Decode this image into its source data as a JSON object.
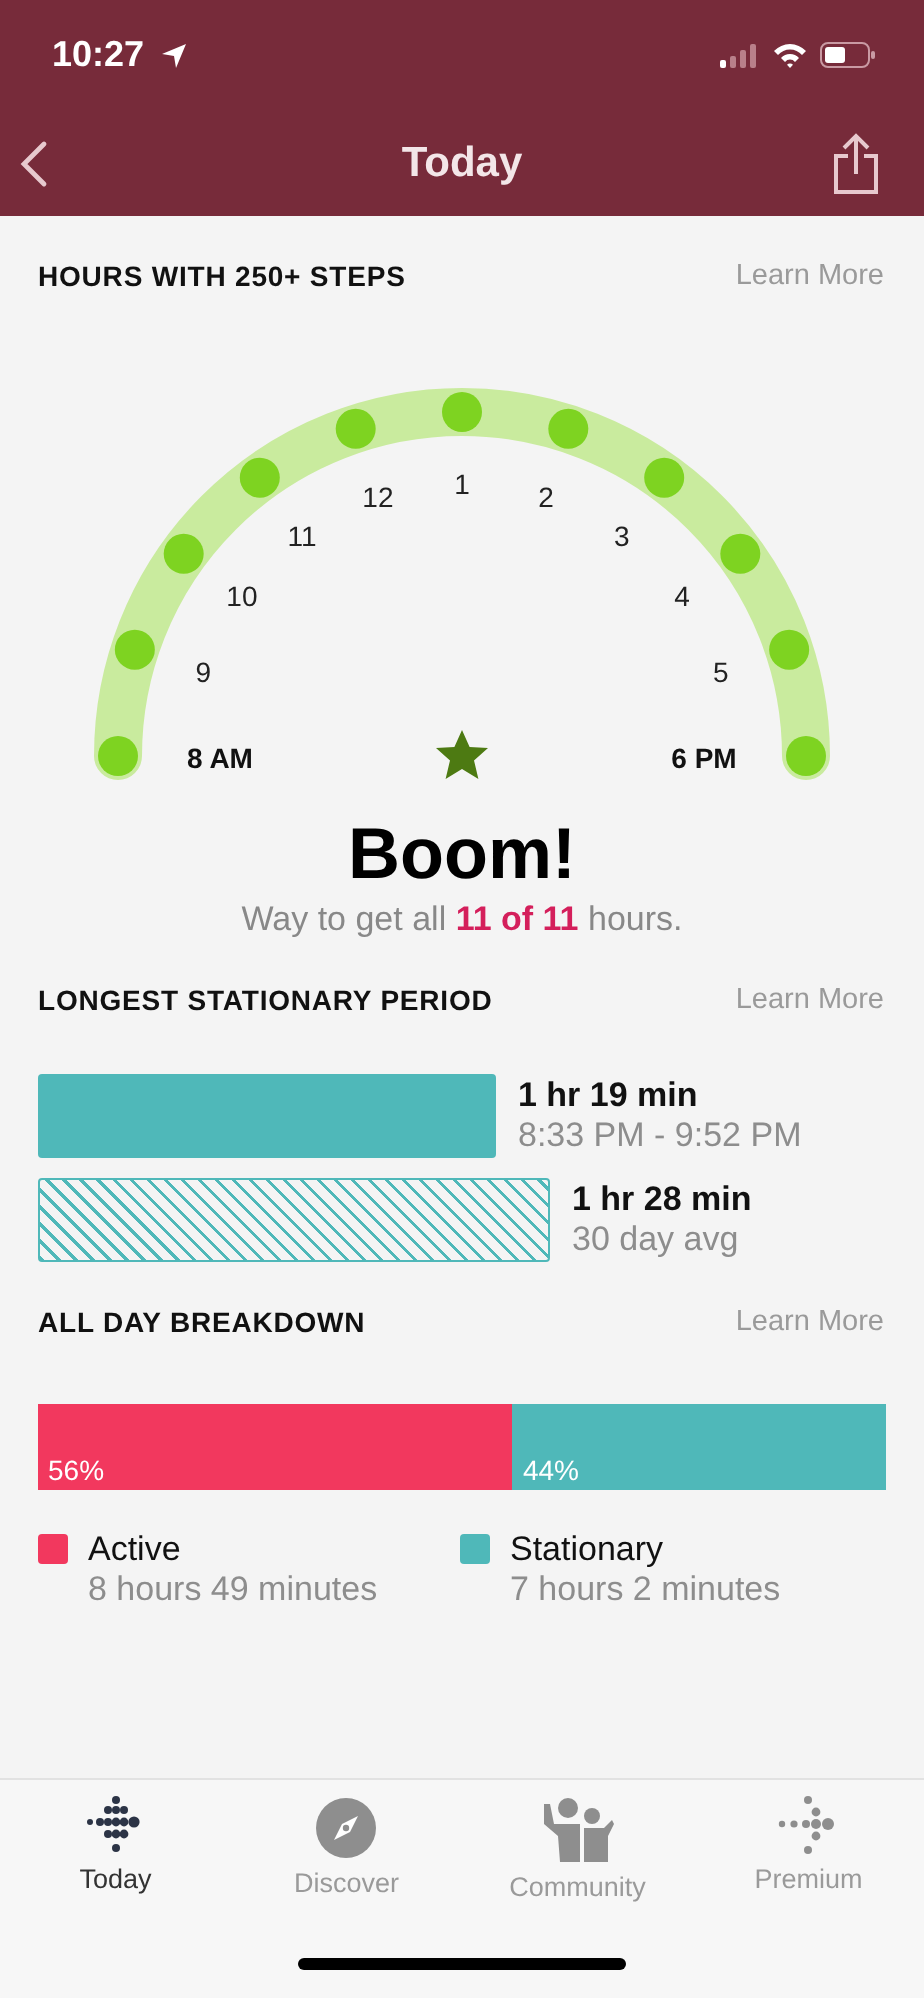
{
  "status_bar": {
    "time": "10:27"
  },
  "nav": {
    "title": "Today"
  },
  "hours_section": {
    "heading": "HOURS WITH 250+ STEPS",
    "link": "Learn More",
    "hours": [
      {
        "met": true
      },
      {
        "met": true
      },
      {
        "met": true
      },
      {
        "met": true
      },
      {
        "met": true
      },
      {
        "met": true
      },
      {
        "met": true
      },
      {
        "met": true
      },
      {
        "met": true
      },
      {
        "met": true
      },
      {
        "met": true
      }
    ],
    "hour_labels": [
      "9",
      "10",
      "11",
      "12",
      "1",
      "2",
      "3",
      "4",
      "5"
    ],
    "start_label": "8 AM",
    "end_label": "6 PM",
    "headline": "Boom!",
    "message": "Way to get all **11 of 11** hours."
  },
  "stationary_section": {
    "heading": "LONGEST STATIONARY PERIOD",
    "link": "Learn More",
    "bars": [
      {
        "kind": "solid",
        "duration": "1 hr 19 min",
        "detail": "8:33 PM - 9:52 PM"
      },
      {
        "kind": "hatched",
        "duration": "1 hr 28 min",
        "detail": "30 day avg"
      }
    ]
  },
  "breakdown_section": {
    "heading": "ALL DAY BREAKDOWN",
    "link": "Learn More",
    "segments": [
      {
        "label": "Active",
        "percent": "56%",
        "level": 0.56,
        "color": "#f2385e",
        "time": "8 hours 49 minutes"
      },
      {
        "label": "Stationary",
        "percent": "44%",
        "color": "#4fb8b9",
        "time": "7 hours 2 minutes"
      }
    ]
  },
  "tab_bar": [
    {
      "label": "Today",
      "selected": true,
      "kind": "today"
    },
    {
      "label": "Discover",
      "selected": false,
      "kind": "discover"
    },
    {
      "label": "Community",
      "selected": false,
      "kind": "community"
    },
    {
      "label": "Premium",
      "selected": false,
      "kind": "premium"
    }
  ]
}
